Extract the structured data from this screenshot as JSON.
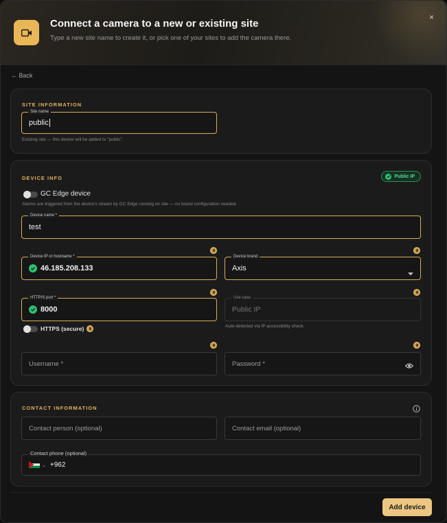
{
  "header": {
    "title": "Connect a camera to a new or existing site",
    "subtitle": "Type a new site name to create it, or pick one of your sites to add the camera there.",
    "close_label": "×"
  },
  "back_label": "← Back",
  "site_info": {
    "title": "SITE INFORMATION",
    "site_name": {
      "label": "Site name",
      "value": "public"
    },
    "hint": "Existing site — this device will be added to \"public\"."
  },
  "device_info": {
    "title": "DEVICE INFO",
    "badge": "Public IP",
    "edge_toggle": {
      "label": "GC Edge device",
      "on": false
    },
    "edge_hint": "Alarms are triggered from the device's stream by GC Edge running on site — no brand configuration needed.",
    "device_name": {
      "label": "Device name *",
      "value": "test"
    },
    "device_ip": {
      "label": "Device IP or hostname *",
      "value": "46.185.208.133"
    },
    "brand": {
      "label": "Device brand",
      "value": "Axis"
    },
    "port": {
      "label": "HTTP/S port *",
      "value": "8000"
    },
    "use_case": {
      "label": "Use case",
      "value": "Public IP"
    },
    "use_case_hint": "Auto-detected via IP accessibility check.",
    "https_toggle": {
      "label": "HTTPS (secure)",
      "on": false
    },
    "username_placeholder": "Username *",
    "password_placeholder": "Password *"
  },
  "contact": {
    "title": "CONTACT INFORMATION",
    "person_placeholder": "Contact person (optional)",
    "email_placeholder": "Contact email (optional)",
    "phone": {
      "label": "Contact phone (optional)",
      "dial_code": "+962"
    }
  },
  "add_button": "Add device",
  "colors": {
    "accent": "#e9b758",
    "success": "#2fbf71",
    "button": "#edc682"
  }
}
